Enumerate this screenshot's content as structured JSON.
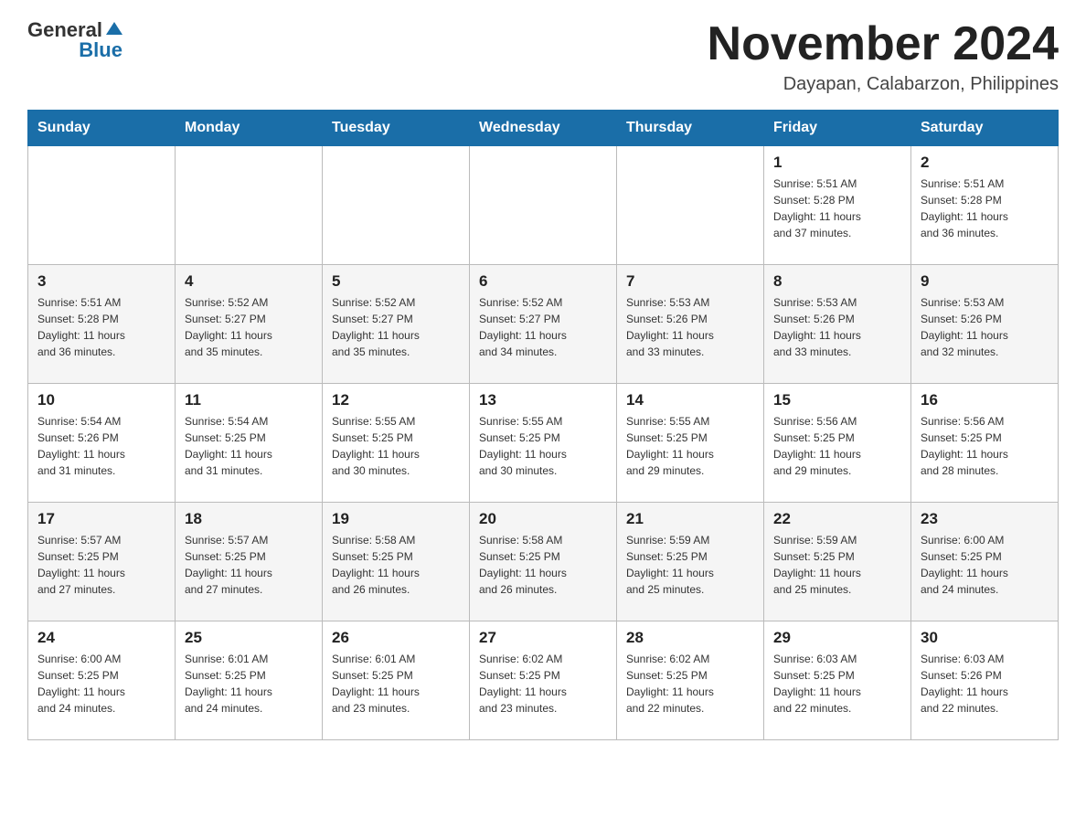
{
  "header": {
    "logo": {
      "general": "General",
      "blue": "Blue"
    },
    "title": "November 2024",
    "subtitle": "Dayapan, Calabarzon, Philippines"
  },
  "calendar": {
    "days_of_week": [
      "Sunday",
      "Monday",
      "Tuesday",
      "Wednesday",
      "Thursday",
      "Friday",
      "Saturday"
    ],
    "weeks": [
      [
        {
          "day": "",
          "info": ""
        },
        {
          "day": "",
          "info": ""
        },
        {
          "day": "",
          "info": ""
        },
        {
          "day": "",
          "info": ""
        },
        {
          "day": "",
          "info": ""
        },
        {
          "day": "1",
          "info": "Sunrise: 5:51 AM\nSunset: 5:28 PM\nDaylight: 11 hours\nand 37 minutes."
        },
        {
          "day": "2",
          "info": "Sunrise: 5:51 AM\nSunset: 5:28 PM\nDaylight: 11 hours\nand 36 minutes."
        }
      ],
      [
        {
          "day": "3",
          "info": "Sunrise: 5:51 AM\nSunset: 5:28 PM\nDaylight: 11 hours\nand 36 minutes."
        },
        {
          "day": "4",
          "info": "Sunrise: 5:52 AM\nSunset: 5:27 PM\nDaylight: 11 hours\nand 35 minutes."
        },
        {
          "day": "5",
          "info": "Sunrise: 5:52 AM\nSunset: 5:27 PM\nDaylight: 11 hours\nand 35 minutes."
        },
        {
          "day": "6",
          "info": "Sunrise: 5:52 AM\nSunset: 5:27 PM\nDaylight: 11 hours\nand 34 minutes."
        },
        {
          "day": "7",
          "info": "Sunrise: 5:53 AM\nSunset: 5:26 PM\nDaylight: 11 hours\nand 33 minutes."
        },
        {
          "day": "8",
          "info": "Sunrise: 5:53 AM\nSunset: 5:26 PM\nDaylight: 11 hours\nand 33 minutes."
        },
        {
          "day": "9",
          "info": "Sunrise: 5:53 AM\nSunset: 5:26 PM\nDaylight: 11 hours\nand 32 minutes."
        }
      ],
      [
        {
          "day": "10",
          "info": "Sunrise: 5:54 AM\nSunset: 5:26 PM\nDaylight: 11 hours\nand 31 minutes."
        },
        {
          "day": "11",
          "info": "Sunrise: 5:54 AM\nSunset: 5:25 PM\nDaylight: 11 hours\nand 31 minutes."
        },
        {
          "day": "12",
          "info": "Sunrise: 5:55 AM\nSunset: 5:25 PM\nDaylight: 11 hours\nand 30 minutes."
        },
        {
          "day": "13",
          "info": "Sunrise: 5:55 AM\nSunset: 5:25 PM\nDaylight: 11 hours\nand 30 minutes."
        },
        {
          "day": "14",
          "info": "Sunrise: 5:55 AM\nSunset: 5:25 PM\nDaylight: 11 hours\nand 29 minutes."
        },
        {
          "day": "15",
          "info": "Sunrise: 5:56 AM\nSunset: 5:25 PM\nDaylight: 11 hours\nand 29 minutes."
        },
        {
          "day": "16",
          "info": "Sunrise: 5:56 AM\nSunset: 5:25 PM\nDaylight: 11 hours\nand 28 minutes."
        }
      ],
      [
        {
          "day": "17",
          "info": "Sunrise: 5:57 AM\nSunset: 5:25 PM\nDaylight: 11 hours\nand 27 minutes."
        },
        {
          "day": "18",
          "info": "Sunrise: 5:57 AM\nSunset: 5:25 PM\nDaylight: 11 hours\nand 27 minutes."
        },
        {
          "day": "19",
          "info": "Sunrise: 5:58 AM\nSunset: 5:25 PM\nDaylight: 11 hours\nand 26 minutes."
        },
        {
          "day": "20",
          "info": "Sunrise: 5:58 AM\nSunset: 5:25 PM\nDaylight: 11 hours\nand 26 minutes."
        },
        {
          "day": "21",
          "info": "Sunrise: 5:59 AM\nSunset: 5:25 PM\nDaylight: 11 hours\nand 25 minutes."
        },
        {
          "day": "22",
          "info": "Sunrise: 5:59 AM\nSunset: 5:25 PM\nDaylight: 11 hours\nand 25 minutes."
        },
        {
          "day": "23",
          "info": "Sunrise: 6:00 AM\nSunset: 5:25 PM\nDaylight: 11 hours\nand 24 minutes."
        }
      ],
      [
        {
          "day": "24",
          "info": "Sunrise: 6:00 AM\nSunset: 5:25 PM\nDaylight: 11 hours\nand 24 minutes."
        },
        {
          "day": "25",
          "info": "Sunrise: 6:01 AM\nSunset: 5:25 PM\nDaylight: 11 hours\nand 24 minutes."
        },
        {
          "day": "26",
          "info": "Sunrise: 6:01 AM\nSunset: 5:25 PM\nDaylight: 11 hours\nand 23 minutes."
        },
        {
          "day": "27",
          "info": "Sunrise: 6:02 AM\nSunset: 5:25 PM\nDaylight: 11 hours\nand 23 minutes."
        },
        {
          "day": "28",
          "info": "Sunrise: 6:02 AM\nSunset: 5:25 PM\nDaylight: 11 hours\nand 22 minutes."
        },
        {
          "day": "29",
          "info": "Sunrise: 6:03 AM\nSunset: 5:25 PM\nDaylight: 11 hours\nand 22 minutes."
        },
        {
          "day": "30",
          "info": "Sunrise: 6:03 AM\nSunset: 5:26 PM\nDaylight: 11 hours\nand 22 minutes."
        }
      ]
    ]
  }
}
